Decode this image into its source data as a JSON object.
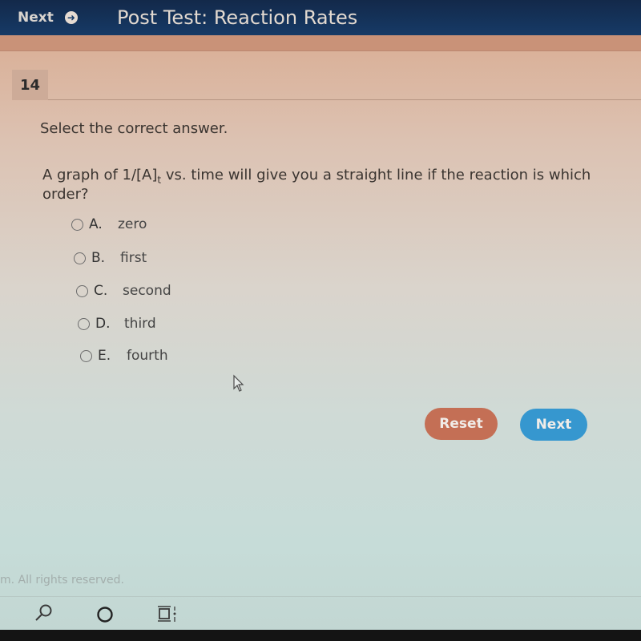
{
  "header": {
    "next_label": "Next",
    "next_icon": "arrow-right-circle-icon",
    "title": "Post Test: Reaction Rates"
  },
  "question": {
    "number": "14",
    "instruction": "Select the correct answer.",
    "text_before": "A graph of 1/[A]",
    "text_subscript": "t",
    "text_after": " vs. time will give you a straight line if the reaction is which order?",
    "options": [
      {
        "letter": "A.",
        "text": "zero",
        "selected": false
      },
      {
        "letter": "B.",
        "text": "first",
        "selected": false
      },
      {
        "letter": "C.",
        "text": "second",
        "selected": false
      },
      {
        "letter": "D.",
        "text": "third",
        "selected": false
      },
      {
        "letter": "E.",
        "text": "fourth",
        "selected": false
      }
    ]
  },
  "actions": {
    "reset_label": "Reset",
    "next_label": "Next",
    "reset_color": "#c46f55",
    "next_color": "#3697cf"
  },
  "footer": {
    "copyright": "m. All rights reserved."
  },
  "taskbar": {
    "icons": [
      "search-icon",
      "cortana-circle-icon",
      "task-view-icon"
    ]
  }
}
